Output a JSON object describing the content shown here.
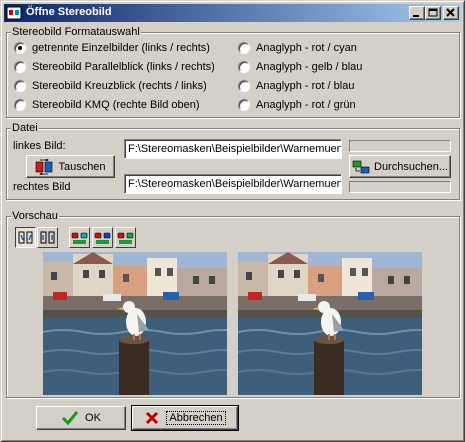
{
  "window": {
    "title": "Öffne Stereobild"
  },
  "format_group": {
    "label": "Stereobild Formatauswahl",
    "options_left": [
      {
        "label": "getrennte Einzelbilder (links / rechts)",
        "selected": true
      },
      {
        "label": "Stereobild Parallelblick (links / rechts)",
        "selected": false
      },
      {
        "label": "Stereobild Kreuzblick (rechts / links)",
        "selected": false
      },
      {
        "label": "Stereobild KMQ (rechte Bild  oben)",
        "selected": false
      }
    ],
    "options_right": [
      {
        "label": "Anaglyph - rot / cyan",
        "selected": false
      },
      {
        "label": "Anaglyph - gelb / blau",
        "selected": false
      },
      {
        "label": "Anaglyph - rot / blau",
        "selected": false
      },
      {
        "label": "Anaglyph - rot / grün",
        "selected": false
      }
    ]
  },
  "file_group": {
    "label": "Datei",
    "left_label": "linkes Bild:",
    "right_label": "rechtes Bild",
    "swap_button": "Tauschen",
    "browse_button": "Durchsuchen...",
    "left_path": "F:\\Stereomasken\\Beispielbilder\\Warnemuen",
    "right_path": "F:\\Stereomasken\\Beispielbilder\\Warnemuen"
  },
  "preview_group": {
    "label": "Vorschau",
    "tools": [
      "split-view-icon",
      "side-by-side-icon",
      "anaglyph-red-cyan-icon",
      "anaglyph-red-blue-icon",
      "anaglyph-red-green-icon"
    ]
  },
  "buttons": {
    "ok": "OK",
    "cancel": "Abbrechen"
  },
  "colors": {
    "title_start": "#0a246a",
    "title_end": "#a6caf0",
    "face": "#d4d0c8",
    "ok_check": "#1a9a1a",
    "cancel_x": "#c00000"
  }
}
